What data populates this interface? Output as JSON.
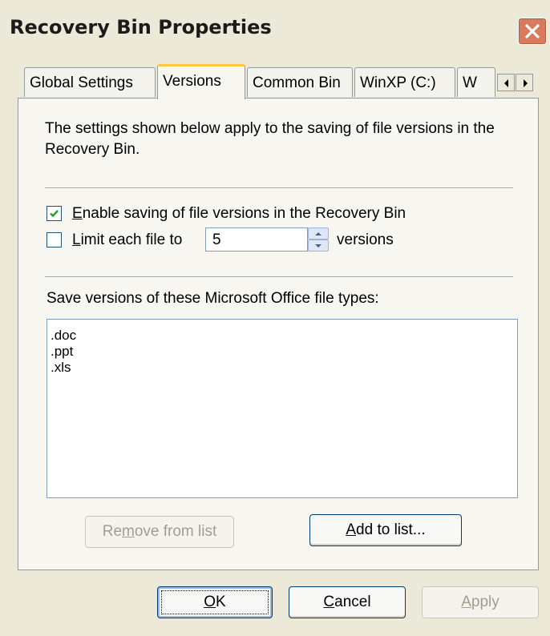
{
  "window": {
    "title": "Recovery Bin Properties"
  },
  "tabs": [
    {
      "label": "Global Settings"
    },
    {
      "label": "Versions"
    },
    {
      "label": "Common Bin"
    },
    {
      "label": "WinXP (C:)"
    },
    {
      "label": "W"
    }
  ],
  "versions": {
    "description": "The settings shown below apply to the saving of file versions in the Recovery Bin.",
    "enable_label_accel": "E",
    "enable_label_rest": "nable saving of file versions in the Recovery Bin",
    "enable_checked": true,
    "limit_label_accel": "L",
    "limit_label_rest": "imit each file to",
    "limit_checked": false,
    "limit_value": "5",
    "versions_suffix": "versions",
    "filetypes_heading": "Save versions of these Microsoft Office file types:",
    "filetypes": [
      ".doc",
      ".ppt",
      ".xls"
    ],
    "remove_pre": "Re",
    "remove_accel": "m",
    "remove_post": "ove from list",
    "add_accel": "A",
    "add_post": "dd to list..."
  },
  "footer": {
    "ok_accel": "O",
    "ok_post": "K",
    "cancel_accel": "C",
    "cancel_post": "ancel",
    "apply_accel": "A",
    "apply_post": "pply"
  }
}
